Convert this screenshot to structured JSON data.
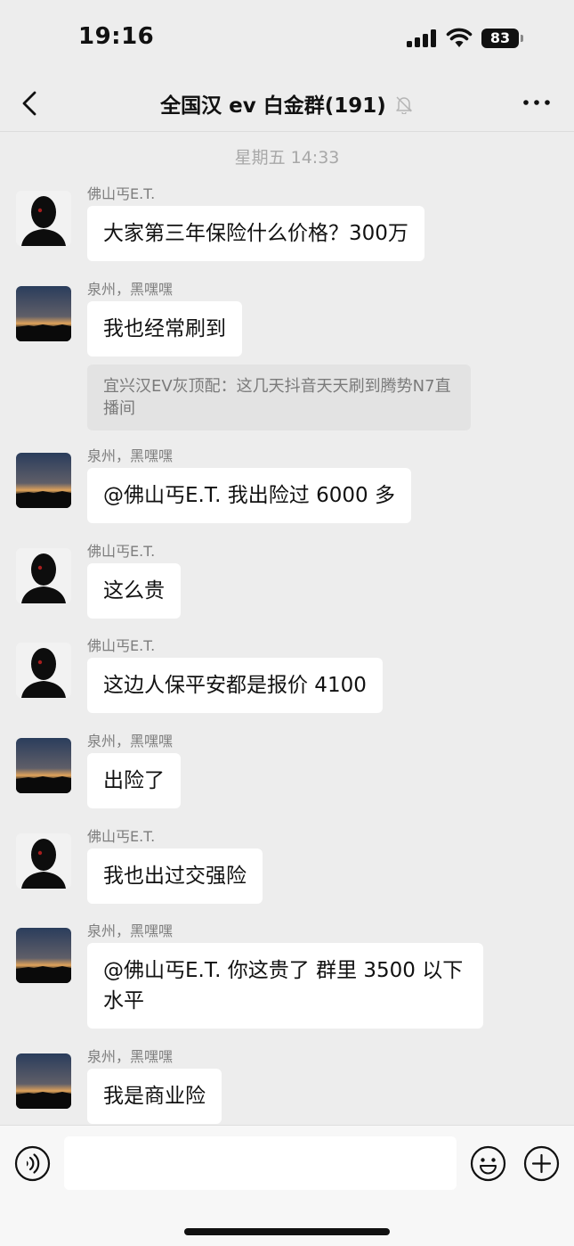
{
  "status_bar": {
    "time": "19:16",
    "battery": "83"
  },
  "nav": {
    "title": "全国汉 ev 白金群(191)"
  },
  "chat": {
    "timestamp": "星期五 14:33",
    "messages": [
      {
        "sender": "佛山丐E.T.",
        "avatar": "person",
        "text": "大家第三年保险什么价格？300万"
      },
      {
        "sender": "泉州，黑嘿嘿",
        "avatar": "sunset",
        "text": "我也经常刷到",
        "quote": "宜兴汉EV灰顶配：这几天抖音天天刷到腾势N7直播间"
      },
      {
        "sender": "泉州，黑嘿嘿",
        "avatar": "sunset",
        "text": "@佛山丐E.T.  我出险过 6000 多"
      },
      {
        "sender": "佛山丐E.T.",
        "avatar": "person",
        "text": "这么贵"
      },
      {
        "sender": "佛山丐E.T.",
        "avatar": "person",
        "text": "这边人保平安都是报价 4100"
      },
      {
        "sender": "泉州，黑嘿嘿",
        "avatar": "sunset",
        "text": "出险了"
      },
      {
        "sender": "佛山丐E.T.",
        "avatar": "person",
        "text": "我也出过交强险"
      },
      {
        "sender": "泉州，黑嘿嘿",
        "avatar": "sunset",
        "text": "@佛山丐E.T. 你这贵了 群里 3500 以下水平"
      },
      {
        "sender": "泉州，黑嘿嘿",
        "avatar": "sunset",
        "text": "我是商业险"
      }
    ]
  },
  "input_bar": {
    "placeholder": ""
  },
  "icons": {
    "back": "chevron-left-icon",
    "mute": "bell-slash-icon",
    "more": "ellipsis-icon",
    "voice": "voice-icon",
    "emoji": "smiley-icon",
    "plus": "plus-circle-icon"
  }
}
